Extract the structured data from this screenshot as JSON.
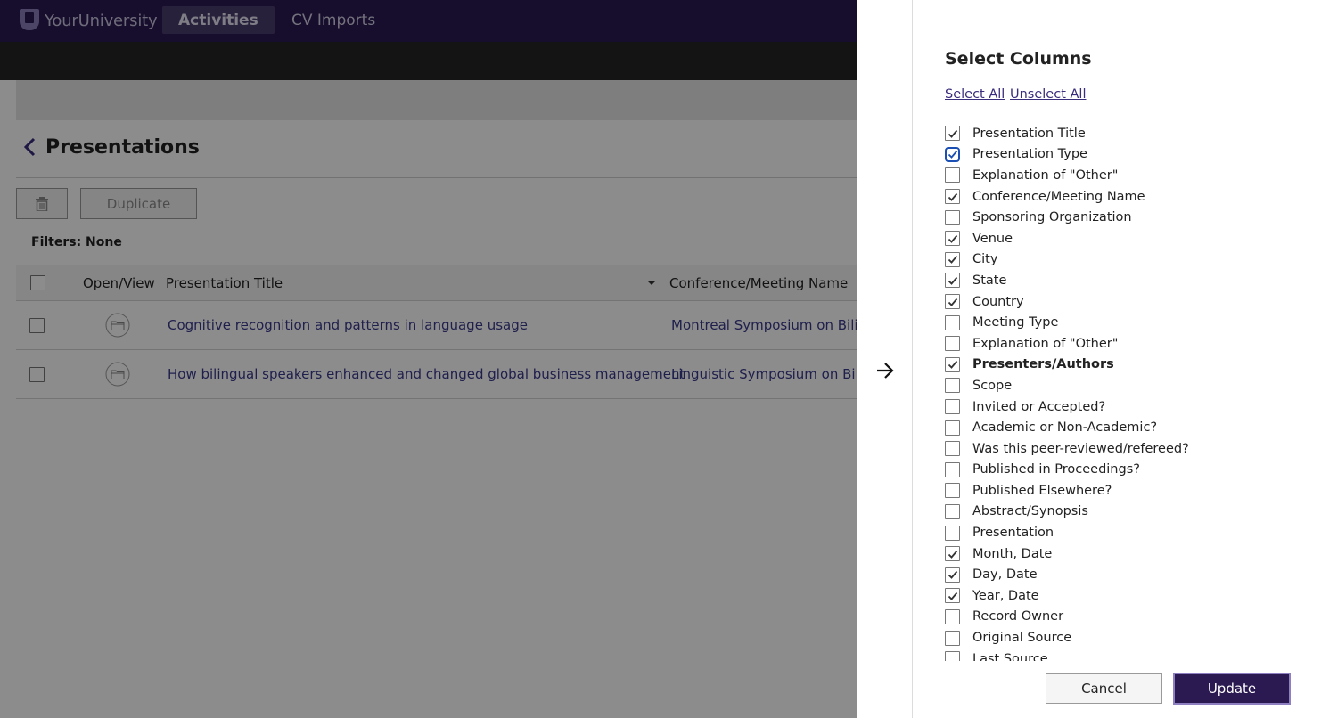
{
  "topbar": {
    "brand": "YourUniversity",
    "nav": [
      {
        "label": "Activities",
        "active": true
      },
      {
        "label": "CV Imports",
        "active": false
      }
    ]
  },
  "page": {
    "title": "Presentations",
    "duplicate_label": "Duplicate",
    "filters_label": "Filters: None"
  },
  "table": {
    "headers": {
      "open_view": "Open/View",
      "title": "Presentation Title",
      "conference": "Conference/Meeting Name"
    },
    "rows": [
      {
        "title": "Cognitive recognition and patterns in language usage",
        "conference": "Montreal Symposium on Bilingu"
      },
      {
        "title": "How bilingual speakers enhanced and changed global business management",
        "conference": "Linguistic Symposium on Bilingu"
      }
    ]
  },
  "panel": {
    "title": "Select Columns",
    "select_all": "Select All",
    "unselect_all": "Unselect All",
    "columns": [
      {
        "label": "Presentation Title",
        "checked": true
      },
      {
        "label": "Presentation Type",
        "checked": true,
        "focused": true
      },
      {
        "label": "Explanation of \"Other\"",
        "checked": false
      },
      {
        "label": "Conference/Meeting Name",
        "checked": true
      },
      {
        "label": "Sponsoring Organization",
        "checked": false
      },
      {
        "label": "Venue",
        "checked": true
      },
      {
        "label": "City",
        "checked": true
      },
      {
        "label": "State",
        "checked": true
      },
      {
        "label": "Country",
        "checked": true
      },
      {
        "label": "Meeting Type",
        "checked": false
      },
      {
        "label": "Explanation of \"Other\"",
        "checked": false
      },
      {
        "label": "Presenters/Authors",
        "checked": true,
        "bold": true
      },
      {
        "label": "Scope",
        "checked": false
      },
      {
        "label": "Invited or Accepted?",
        "checked": false
      },
      {
        "label": "Academic or Non-Academic?",
        "checked": false
      },
      {
        "label": "Was this peer-reviewed/refereed?",
        "checked": false
      },
      {
        "label": "Published in Proceedings?",
        "checked": false
      },
      {
        "label": "Published Elsewhere?",
        "checked": false
      },
      {
        "label": "Abstract/Synopsis",
        "checked": false
      },
      {
        "label": "Presentation",
        "checked": false
      },
      {
        "label": "Month, Date",
        "checked": true
      },
      {
        "label": "Day, Date",
        "checked": true
      },
      {
        "label": "Year, Date",
        "checked": true
      },
      {
        "label": "Record Owner",
        "checked": false
      },
      {
        "label": "Original Source",
        "checked": false
      },
      {
        "label": "Last Source",
        "checked": false
      }
    ],
    "cancel_label": "Cancel",
    "update_label": "Update"
  },
  "colors": {
    "brand_purple": "#2b1a52",
    "link_blue": "#3a3a8c",
    "focus_blue": "#1b4fb3"
  }
}
